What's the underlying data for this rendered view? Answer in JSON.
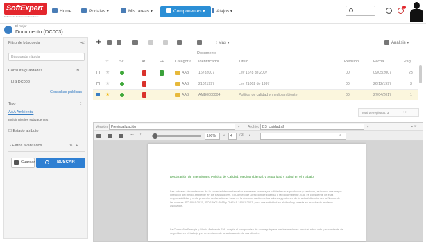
{
  "brand": {
    "name": "SoftExpert",
    "tagline": "Software for Performance Excellence"
  },
  "nav": {
    "home": "Home",
    "portals": "Portales",
    "my_tasks": "Mis tareas",
    "components": "Componentes",
    "shortcuts": "Atajos"
  },
  "header": {
    "subtitle": "El mejor",
    "title": "Documento (DC003)"
  },
  "left": {
    "title": "Filtro de búsqueda",
    "search_placeholder": "Búsqueda rápida",
    "saved_queries": "Consulta guardadas",
    "query_item": "LIS DC003",
    "public_queries": "Consultas públicas",
    "type_label": "Tipo",
    "type_value": "AAA Ambiental",
    "include_sub": "Incluir niveles subyacentes",
    "attribute": "Estado atributo",
    "filter_advanced": "Filtros avanzados",
    "save": "Guardar",
    "search": "BUSCAR"
  },
  "toolbar": {
    "more": "Más",
    "analytics": "Análisis"
  },
  "table": {
    "headers": {
      "sit": "Sit.",
      "at": "At.",
      "fp": "FP",
      "category": "Categoría",
      "identifier": "Identificador",
      "title": "Título",
      "group": "Documento",
      "revision": "Revisión",
      "date": "Fecha",
      "pages": "Pág."
    },
    "rows": [
      {
        "category": "AAB",
        "identifier": "16782007",
        "title": "Ley 1678 de 2007",
        "revision": "00",
        "date": "09/05/2007",
        "pages": "23"
      },
      {
        "category": "AAB",
        "identifier": "21021997",
        "title": "Ley 21002 de 1997",
        "revision": "00",
        "date": "26/12/1997",
        "pages": "3"
      },
      {
        "category": "AAB",
        "identifier": "AMB0000004",
        "title": "Política de calidad y medio ambiente",
        "revision": "00",
        "date": "27/04/2017",
        "pages": "1"
      }
    ],
    "pager": "Total de registros: 3"
  },
  "viewer": {
    "version_label": "Versión",
    "version_value": "Previsualización",
    "file_label": "Archivo",
    "file_value": "BS_calidad.rtf",
    "zoom": "100%",
    "page": "4",
    "page_total": "3"
  },
  "doc": {
    "heading": "Declaración de Intenciones: Política de Calidad, Medioambiental, y Seguridad y Salud en el Trabajo.",
    "para1": "Las actuales circunstancias de la sociedad demandan a las empresas una mayor calidad en sus productos y servicios, así como una mayor dirección del medio ambiente en los trabajadores. El Consejo de Dirección de Energía y Medio Ambiente, S.A. es consciente de esta responsabilidad y en la presente declaración se basa en la documentación de los valores y patrones de la actual dirección en la Norma de las normas ISO 9001:2015, ISO 14001:2015 y OHSAS 18001:2007, para una actividad en el diseño y puesta en marcha de modelos asociados.",
    "para2": "La Compañía Energía y Medio Ambiente S.A. acepta el compromiso de conseguir para sus instalaciones un nivel adecuado y ascendente de seguridad en el trabajo y el crecimiento de la satisfacción de sus clientes."
  }
}
